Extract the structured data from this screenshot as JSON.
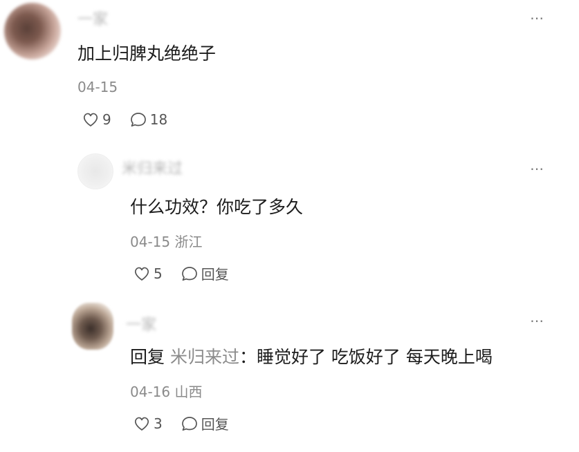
{
  "comment": {
    "username": "一家",
    "text": "加上归脾丸绝绝子",
    "date": "04-15",
    "likes": "9",
    "replies": "18"
  },
  "reply1": {
    "username": "米归来过",
    "text": "什么功效？你吃了多久",
    "date": "04-15",
    "location": "浙江",
    "likes": "5",
    "reply_label": "回复"
  },
  "reply2": {
    "username": "一家",
    "prefix": "回复",
    "mention": "米归来过",
    "text": "：睡觉好了 吃饭好了 每天晚上喝",
    "date": "04-16",
    "location": "山西",
    "likes": "3",
    "reply_label": "回复"
  },
  "more_icon": "⋯",
  "icons": [
    "heart-outline-icon",
    "comment-bubble-icon",
    "more-dots-icon"
  ],
  "colors": {
    "text": "#1c1c1c",
    "meta": "#8a8a8a",
    "mention": "#8c8c8c"
  }
}
